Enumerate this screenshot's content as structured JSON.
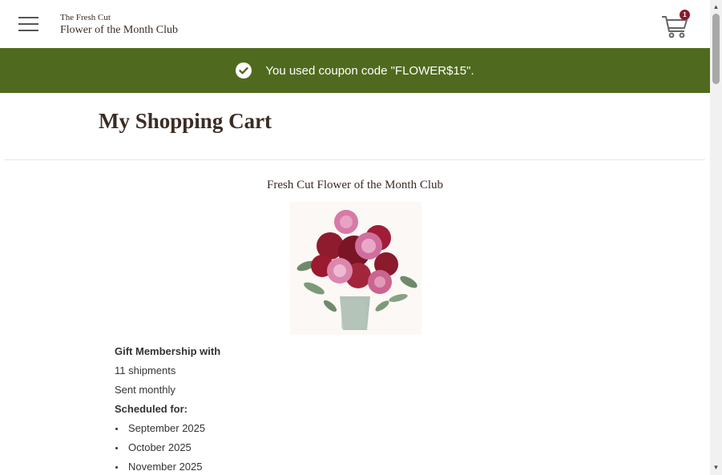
{
  "header": {
    "logo_small": "The Fresh Cut",
    "logo_big": "Flower of the Month Club",
    "cart_count": "1"
  },
  "banner": {
    "message": "You used coupon code \"FLOWER$15\"."
  },
  "page": {
    "title": "My Shopping Cart"
  },
  "product": {
    "name": "Fresh Cut Flower of the Month Club",
    "gift_label": "Gift Membership with",
    "shipments": "11 shipments",
    "frequency": "Sent monthly",
    "scheduled_label": "Scheduled for:",
    "schedule": [
      "September 2025",
      "October 2025",
      "November 2025"
    ]
  },
  "colors": {
    "banner_bg": "#4f6a1e",
    "badge_bg": "#8b1a2b",
    "text": "#3a2c25"
  }
}
